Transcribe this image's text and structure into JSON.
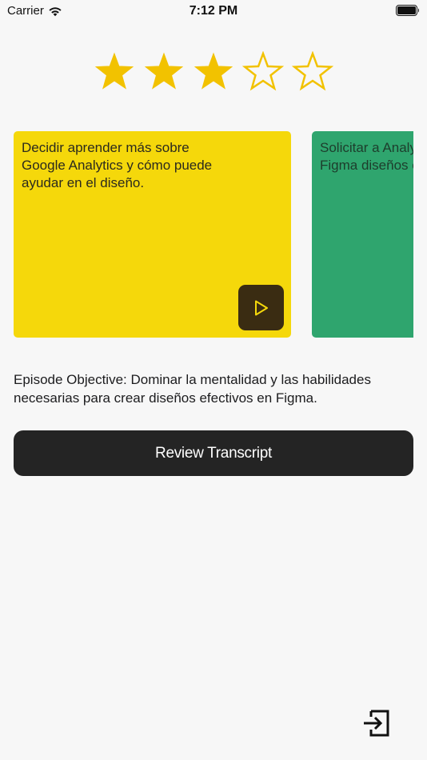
{
  "status_bar": {
    "carrier": "Carrier",
    "time": "7:12 PM",
    "icons": [
      "wifi-icon",
      "battery-icon"
    ]
  },
  "rating": {
    "value": 3,
    "max": 5,
    "filled_color": "#f2c200",
    "icon": "star-icon"
  },
  "cards": [
    {
      "text": "Decidir aprender más sobre Google Analytics y cómo puede ayudar en el diseño.",
      "color": "#f5d80b",
      "play_icon": "play-icon"
    },
    {
      "text": "Solicitar a Analytics cómo utilizar Figma diseños efectivos",
      "color": "#2fa56e"
    }
  ],
  "objective": {
    "text": "Episode Objective: Dominar la mentalidad y las habilidades necesarias para crear diseños efectivos en Figma."
  },
  "review_button": {
    "label": "Review Transcript"
  },
  "exit": {
    "icon": "exit-icon"
  }
}
